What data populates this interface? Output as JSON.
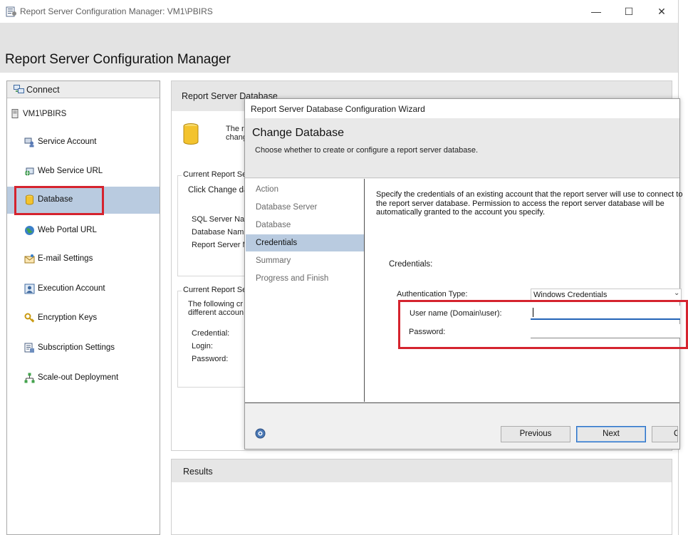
{
  "window": {
    "title": "Report Server Configuration Manager: VM1\\PBIRS",
    "minimize": "—",
    "maximize": "☐",
    "close": "✕"
  },
  "app": {
    "title": "Report Server Configuration Manager"
  },
  "sidebar": {
    "connect_label": "Connect",
    "server": "VM1\\PBIRS",
    "items": [
      {
        "label": "Service Account",
        "icon": "service-account-icon"
      },
      {
        "label": "Web Service URL",
        "icon": "web-service-url-icon"
      },
      {
        "label": "Database",
        "icon": "database-icon",
        "selected": true
      },
      {
        "label": "Web Portal URL",
        "icon": "globe-icon"
      },
      {
        "label": "E-mail Settings",
        "icon": "email-icon"
      },
      {
        "label": "Execution Account",
        "icon": "execution-account-icon"
      },
      {
        "label": "Encryption Keys",
        "icon": "key-icon"
      },
      {
        "label": "Subscription Settings",
        "icon": "subscription-icon"
      },
      {
        "label": "Scale-out Deployment",
        "icon": "scaleout-icon"
      }
    ]
  },
  "main": {
    "title": "Report Server Database",
    "intro_line1": "The re",
    "intro_line2": "chang",
    "group1_label": "Current Report Se",
    "group1_text": "Click Change da",
    "sql_server": "SQL Server Nar",
    "database_name": "Database Nam",
    "report_server": "Report Server M",
    "group2_label": "Current Report Se",
    "group2_line1": "The following cr",
    "group2_line2": "different accoun",
    "credential": "Credential:",
    "login": "Login:",
    "password": "Password:"
  },
  "results": {
    "title": "Results"
  },
  "wizard": {
    "title": "Report Server Database Configuration Wizard",
    "heading": "Change Database",
    "subheading": "Choose whether to create or configure a report server database.",
    "steps": [
      "Action",
      "Database Server",
      "Database",
      "Credentials",
      "Summary",
      "Progress and Finish"
    ],
    "active_step": "Credentials",
    "description_line1": "Specify the credentials of an existing account that the report server will use to connect to",
    "description_line2": "the report server database.  Permission to access the report server database will be",
    "description_line3": "automatically granted to the account you specify.",
    "credentials_label": "Credentials:",
    "auth_type_label": "Authentication Type:",
    "auth_type_value": "Windows Credentials",
    "username_label": "User name (Domain\\user):",
    "username_value": "",
    "password_label": "Password:",
    "password_value": "",
    "previous_button": "Previous",
    "next_button": "Next",
    "cancel_button": "C"
  },
  "colors": {
    "accent_selection": "#b9cbe0",
    "annotation_red": "#d5232e",
    "focus_blue": "#2364b8"
  }
}
